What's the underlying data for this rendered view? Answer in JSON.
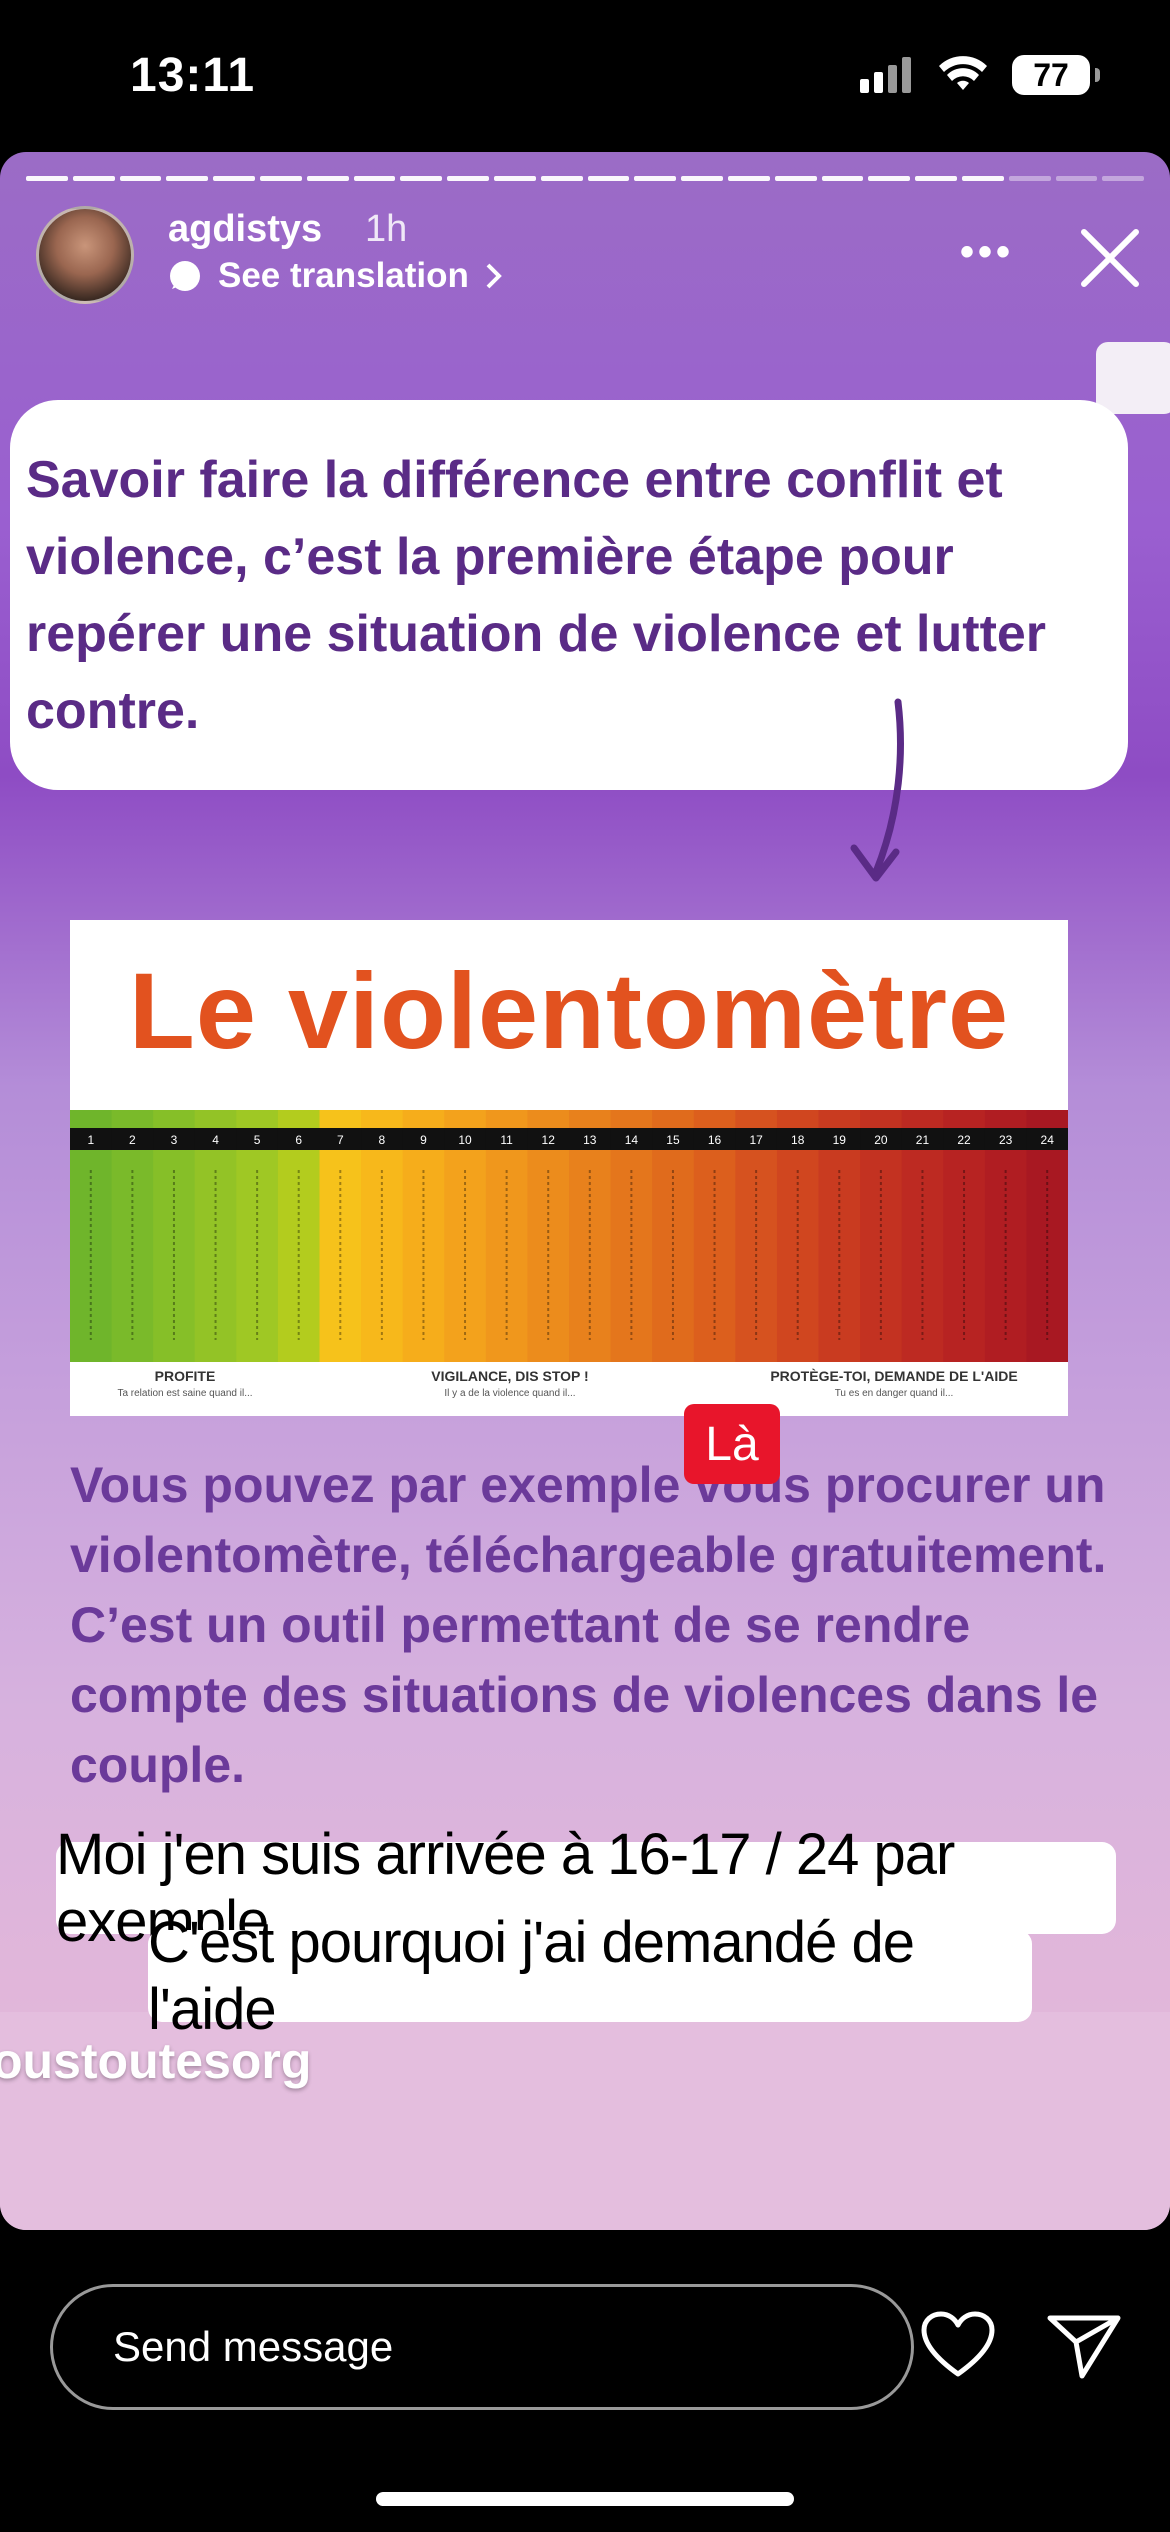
{
  "status_bar": {
    "time": "13:11",
    "battery": "77"
  },
  "story": {
    "username": "agdistys",
    "time_ago": "1h",
    "translation_label": "See translation",
    "card_text": "Savoir faire la différence entre conflit et violence, c’est la première étape pour repérer une situation de violence et lutter contre.",
    "meter_title": "Le violentomètre",
    "meter_numbers": [
      "1",
      "2",
      "3",
      "4",
      "5",
      "6",
      "7",
      "8",
      "9",
      "10",
      "11",
      "12",
      "13",
      "14",
      "15",
      "16",
      "17",
      "18",
      "19",
      "20",
      "21",
      "22",
      "23",
      "24"
    ],
    "meter_sections": [
      {
        "title": "PROFITE",
        "sub": "Ta relation est saine quand il..."
      },
      {
        "title": "VIGILANCE, DIS STOP !",
        "sub": "Il y a de la violence quand il..."
      },
      {
        "title": "PROTÈGE-TOI, DEMANDE DE L'AIDE",
        "sub": "Tu es en danger quand il..."
      }
    ],
    "badge": "Là",
    "paragraph": "Vous pouvez par exemple vous procurer un violentomètre, téléchargeable gratuitement. C’est un outil permettant de se rendre compte des situations de violences dans le couple.",
    "caption_line_1": "Moi j'en suis arrivée à 16-17 / 24 par exemple",
    "caption_line_2": "C'est pourquoi j'ai demandé de l'aide",
    "handle": "oustoutesorg",
    "colors": {
      "accent_purple": "#5a2b86",
      "meter_orange": "#e2521f",
      "badge_red": "#e8152b"
    }
  },
  "reply_bar": {
    "placeholder": "Send message"
  },
  "icons": [
    "close-icon",
    "more-icon",
    "translate-icon",
    "heart-icon",
    "send-icon",
    "wifi-icon",
    "signal-icon"
  ]
}
